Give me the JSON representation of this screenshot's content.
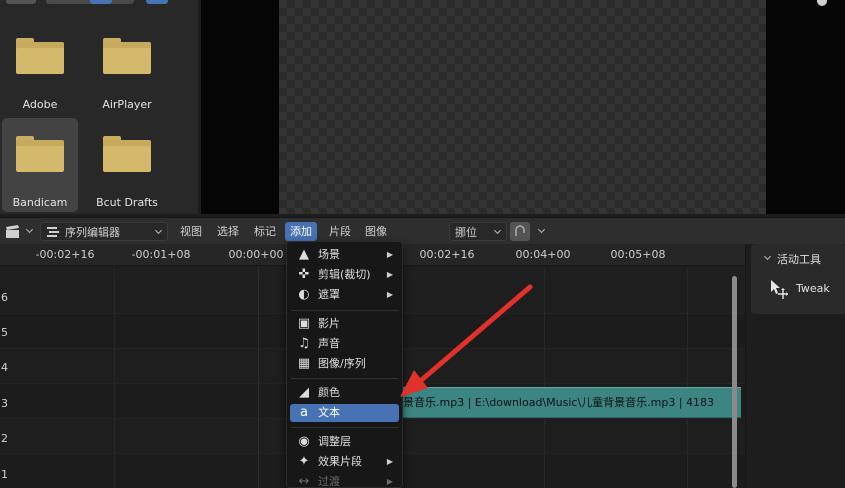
{
  "file_browser": {
    "items": [
      {
        "label": "Adobe",
        "selected": false
      },
      {
        "label": "AirPlayer",
        "selected": false
      },
      {
        "label": "Bandicam",
        "selected": true
      },
      {
        "label": "Bcut Drafts",
        "selected": false
      }
    ]
  },
  "header": {
    "editor_type": "序列编辑器",
    "menus": {
      "view": "视图",
      "select": "选择",
      "marker": "标记",
      "add": "添加",
      "strip": "片段",
      "image": "图像"
    },
    "snap_mode": "挪位"
  },
  "timeline": {
    "ruler": [
      "-00:02+16",
      "-00:01+08",
      "00:00+00",
      "00:02+16",
      "00:04+00",
      "00:05+08"
    ],
    "channels": [
      "6",
      "5",
      "4",
      "3",
      "2",
      "1"
    ],
    "strip_text": "景音乐.mp3 | E:\\download\\Music\\儿童背景音乐.mp3 | 4183",
    "strip_color": "#3c8582"
  },
  "tool_panel": {
    "title": "活动工具",
    "tool": "Tweak"
  },
  "add_menu": {
    "items": [
      {
        "label": "场景",
        "icon": "scene-icon",
        "submenu": true
      },
      {
        "label": "剪辑(裁切)",
        "icon": "clip-icon",
        "submenu": true
      },
      {
        "label": "遮罩",
        "icon": "mask-icon",
        "submenu": true
      },
      {
        "label": "影片",
        "icon": "movie-icon",
        "submenu": false
      },
      {
        "label": "声音",
        "icon": "sound-icon",
        "submenu": false
      },
      {
        "label": "图像/序列",
        "icon": "image-icon",
        "submenu": false
      },
      {
        "label": "颜色",
        "icon": "color-icon",
        "submenu": false
      },
      {
        "label": "文本",
        "icon": "text-icon",
        "submenu": false,
        "highlighted": true
      },
      {
        "label": "调整层",
        "icon": "adjustment-icon",
        "submenu": false
      },
      {
        "label": "效果片段",
        "icon": "effect-icon",
        "submenu": true
      },
      {
        "label": "过渡",
        "icon": "transition-icon",
        "submenu": true,
        "disabled": true
      }
    ]
  },
  "colors": {
    "accent": "#4772b3",
    "arrow": "#e0312b",
    "folder": "#d4b86b"
  }
}
